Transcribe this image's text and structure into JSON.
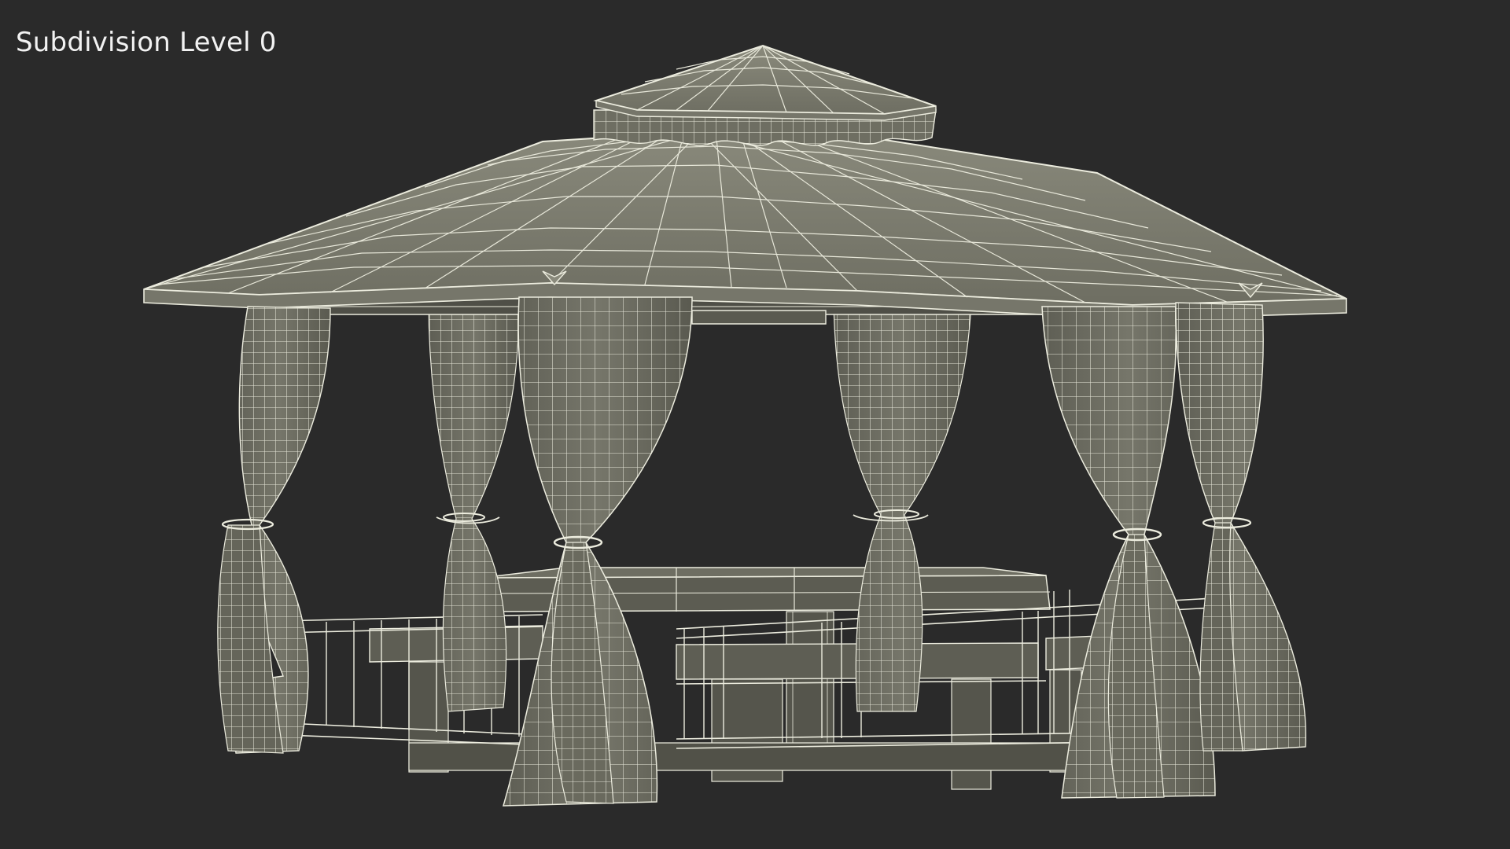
{
  "viewport": {
    "label": "Subdivision Level 0"
  },
  "scene": {
    "subject": "gazebo-wireframe",
    "colors": {
      "background": "#2a2a2a",
      "surface": "#7a7a6c",
      "surface_dark": "#5a5a50",
      "wire": "#ececde"
    }
  }
}
